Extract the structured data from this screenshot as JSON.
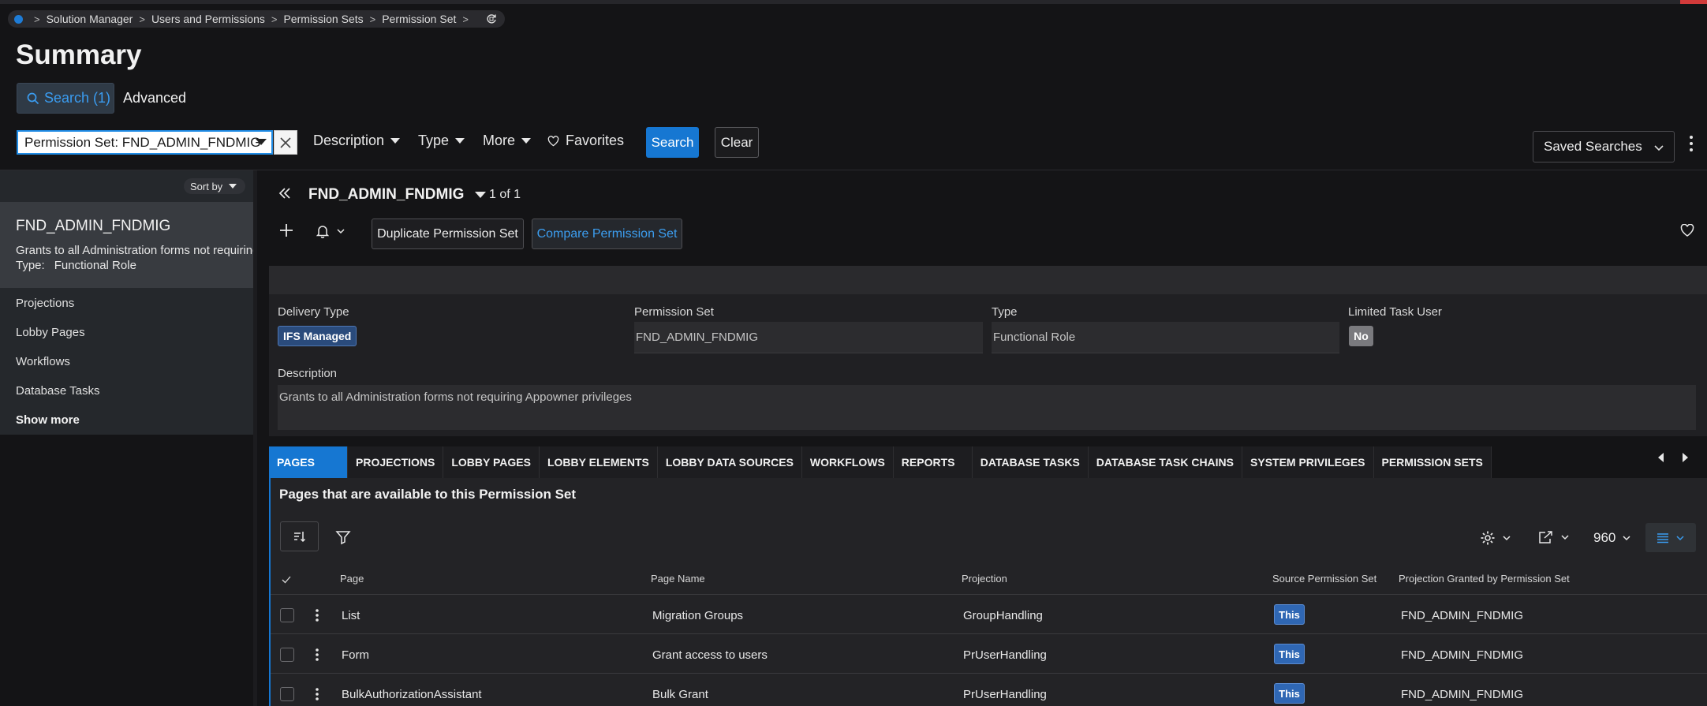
{
  "breadcrumb": [
    "Solution Manager",
    "Users and Permissions",
    "Permission Sets",
    "Permission Set"
  ],
  "page_title": "Summary",
  "search": {
    "tab_label": "Search (1)",
    "advanced_label": "Advanced",
    "field_value": "Permission Set: FND_ADMIN_FNDMIG",
    "filters": [
      "Description",
      "Type",
      "More"
    ],
    "favorites_label": "Favorites",
    "search_button": "Search",
    "clear_button": "Clear",
    "saved_searches": "Saved Searches"
  },
  "left_panel": {
    "sort_label": "Sort by",
    "record_title": "FND_ADMIN_FNDMIG",
    "record_desc": "Grants to all Administration forms not requiring Appowner privileges",
    "record_type_label": "Type:",
    "record_type_value": "Functional Role",
    "nav": [
      "Projections",
      "Lobby Pages",
      "Workflows",
      "Database Tasks"
    ],
    "show_more": "Show more"
  },
  "record": {
    "name": "FND_ADMIN_FNDMIG",
    "count": "1 of 1",
    "duplicate_button": "Duplicate Permission Set",
    "compare_button": "Compare Permission Set"
  },
  "details": {
    "delivery_type_label": "Delivery Type",
    "delivery_type_value": "IFS Managed",
    "permission_set_label": "Permission Set",
    "permission_set_value": "FND_ADMIN_FNDMIG",
    "type_label": "Type",
    "type_value": "Functional Role",
    "limited_label": "Limited Task User",
    "limited_value": "No",
    "description_label": "Description",
    "description_value": "Grants to all Administration forms not requiring Appowner privileges"
  },
  "tabs": [
    "PAGES",
    "PROJECTIONS",
    "LOBBY PAGES",
    "LOBBY ELEMENTS",
    "LOBBY DATA SOURCES",
    "WORKFLOWS",
    "REPORTS",
    "DATABASE TASKS",
    "DATABASE TASK CHAINS",
    "SYSTEM PRIVILEGES",
    "PERMISSION SETS"
  ],
  "table": {
    "title": "Pages that are available to this Permission Set",
    "page_size": "960",
    "columns": [
      "Page",
      "Page Name",
      "Projection",
      "Source Permission Set",
      "Projection Granted by Permission Set"
    ],
    "rows": [
      {
        "page": "List",
        "page_name": "Migration Groups",
        "projection": "GroupHandling",
        "source": "This",
        "granted": "FND_ADMIN_FNDMIG"
      },
      {
        "page": "Form",
        "page_name": "Grant access to users",
        "projection": "PrUserHandling",
        "source": "This",
        "granted": "FND_ADMIN_FNDMIG"
      },
      {
        "page": "BulkAuthorizationAssistant",
        "page_name": "Bulk Grant",
        "projection": "PrUserHandling",
        "source": "This",
        "granted": "FND_ADMIN_FNDMIG"
      }
    ]
  },
  "colors": {
    "accent": "#1677d2",
    "link": "#3c9ef0",
    "badge_managed": "#2a4b7c",
    "badge_this": "#2f67b4"
  }
}
